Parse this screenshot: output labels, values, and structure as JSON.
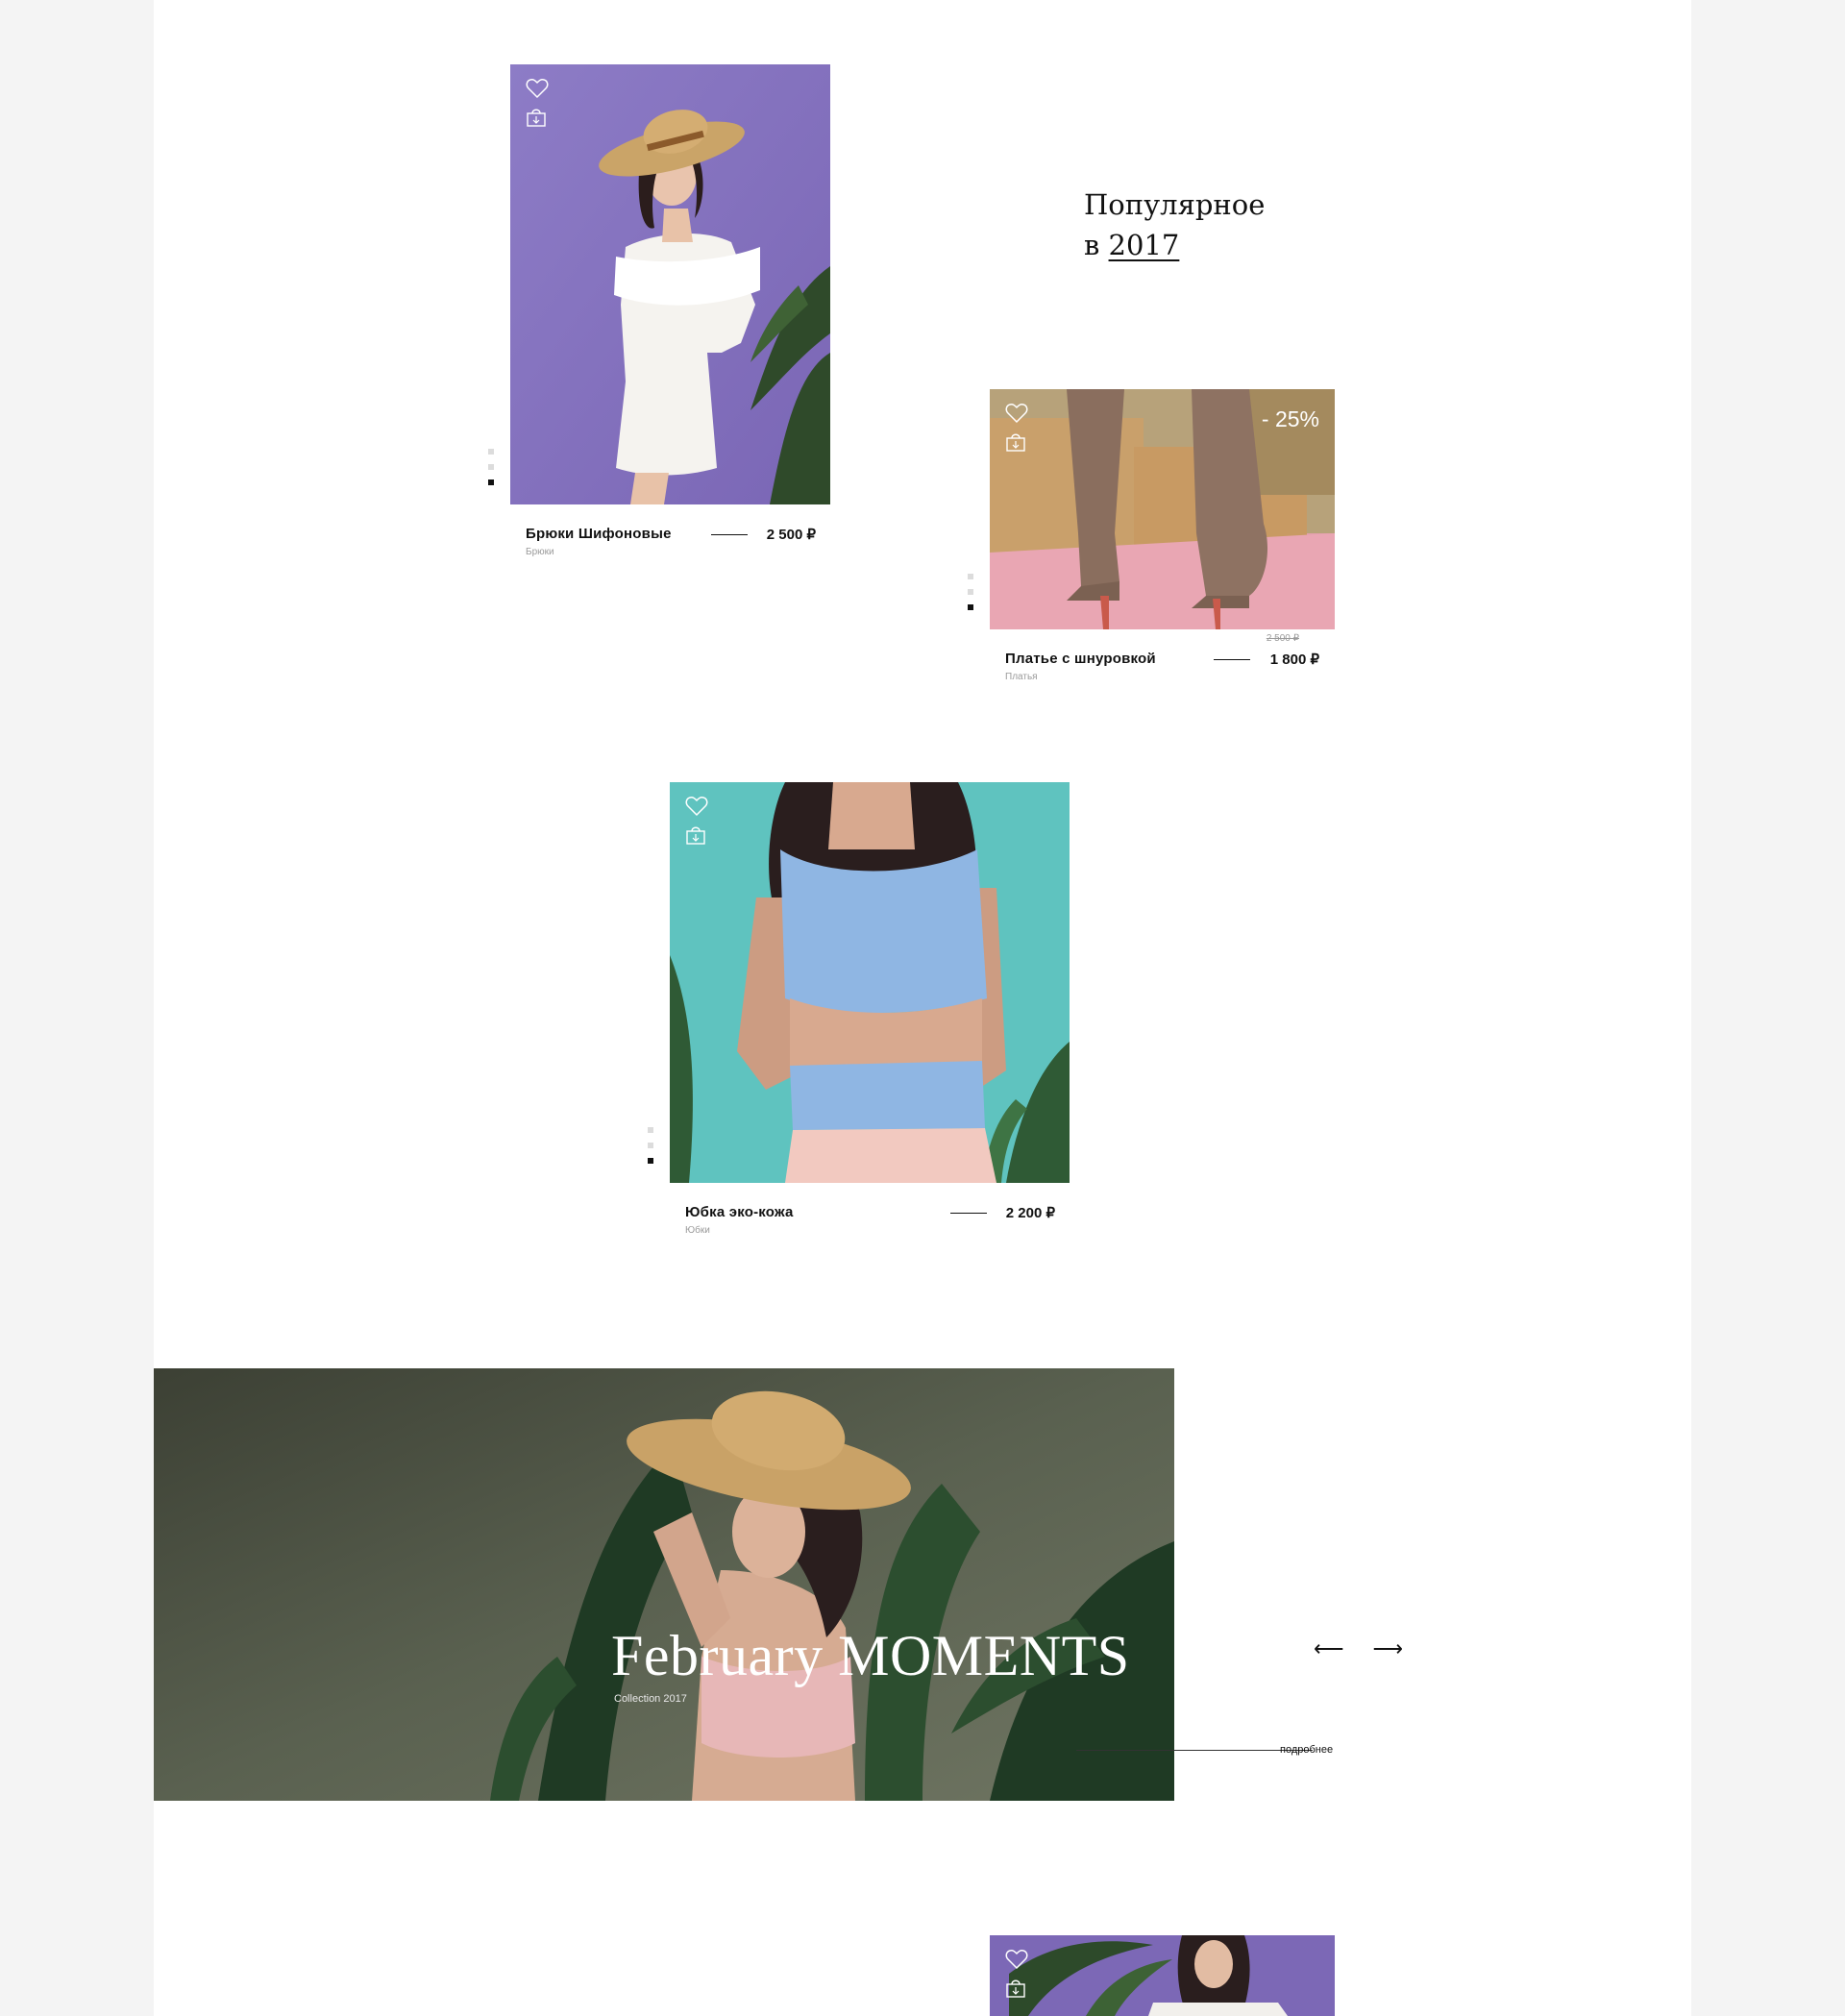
{
  "section": {
    "heading_line1": "Популярное",
    "heading_line2_prefix": "в",
    "heading_year": "2017"
  },
  "products": [
    {
      "name": "Брюки Шифоновые",
      "category": "Брюки",
      "price": "2 500 ₽"
    },
    {
      "name": "Платье с шнуровкой",
      "category": "Платья",
      "price": "1 800 ₽",
      "old_price": "2 500 ₽",
      "discount": "- 25%"
    },
    {
      "name": "Юбка эко-кожа",
      "category": "Юбки",
      "price": "2 200 ₽"
    }
  ],
  "banner": {
    "title": "February MOMENTS",
    "subtitle": "Collection 2017",
    "prev_arrow": "⟵",
    "next_arrow": "⟶",
    "more_label": "подробнее"
  },
  "icons": [
    "heart-icon",
    "bag-icon"
  ],
  "colors": {
    "card1_bg": "#8a78c0",
    "card2_bg": "#c9a070",
    "card3_bg": "#5fc2bf",
    "banner_bg": "#5a6150",
    "card4_bg": "#7c68b6"
  }
}
